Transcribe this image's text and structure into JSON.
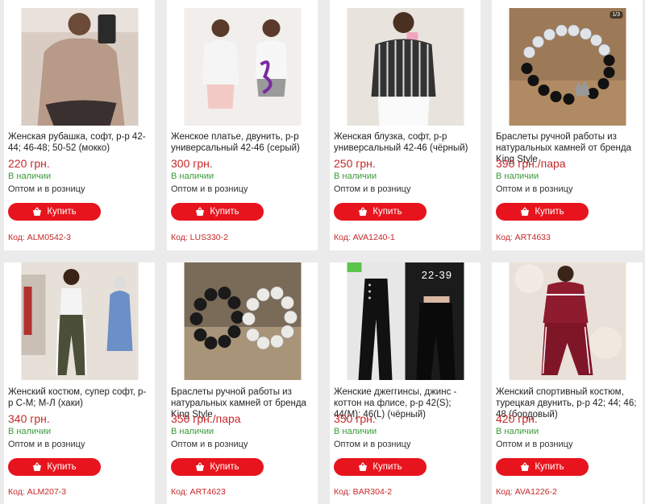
{
  "buy_label": "Купить",
  "colors": {
    "accent": "#e8141d",
    "price": "#c62828",
    "stock": "#3a9a3a"
  },
  "products": [
    {
      "title": "Женская рубашка, софт, р-р 42-44; 46-48; 50-52 (мокко)",
      "price": "220 грн.",
      "stock": "В наличии",
      "wholesale": "Оптом и в розницу",
      "code": "Код: ALM0542-3",
      "image": "woman-beige-shirt-photo"
    },
    {
      "title": "Женское платье, двунить, р-р универсальный 42-46 (серый)",
      "price": "300 грн.",
      "stock": "В наличии",
      "wholesale": "Оптом и в розницу",
      "code": "Код: LUS330-2",
      "image": "woman-grey-dress-photo"
    },
    {
      "title": "Женская блузка, софт, р-р универсальный 42-46 (чёрный)",
      "price": "250 грн.",
      "stock": "В наличии",
      "wholesale": "Оптом и в розницу",
      "code": "Код: AVA1240-1",
      "image": "woman-striped-blouse-photo"
    },
    {
      "title": "Браслеты ручной работы из натуральных камней от бренда King Style",
      "price": "390 грн./пара",
      "stock": "В наличии",
      "wholesale": "Оптом и в розницу",
      "code": "Код: ART4633",
      "image": "crystal-bead-bracelets-photo",
      "badge": "1/3"
    },
    {
      "title": "Женский костюм, супер софт, р-р С-М; М-Л (хаки)",
      "price": "340 грн.",
      "stock": "В наличии",
      "wholesale": "Оптом и в розницу",
      "code": "Код: ALM207-3",
      "image": "woman-khaki-suit-photo"
    },
    {
      "title": "Браслеты ручной работы из натуральных камней от бренда King Style",
      "price": "350 грн./пара",
      "stock": "В наличии",
      "wholesale": "Оптом и в розницу",
      "code": "Код: ART4623",
      "image": "stone-bead-bracelets-photo"
    },
    {
      "title": "Женские джеггинсы, джинс - коттон на флисе, р-р 42(S); 44(M); 46(L) (чёрный)",
      "price": "350 грн.",
      "stock": "В наличии",
      "wholesale": "Оптом и в розницу",
      "code": "Код: BAR304-2",
      "image": "black-jeggings-photo",
      "overlay": "22-39"
    },
    {
      "title": "Женский спортивный костюм, турецкая двунить, р-р 42; 44; 46; 48 (бордовый)",
      "price": "420 грн.",
      "stock": "В наличии",
      "wholesale": "Оптом и в розницу",
      "code": "Код: AVA1226-2",
      "image": "burgundy-tracksuit-photo"
    }
  ]
}
